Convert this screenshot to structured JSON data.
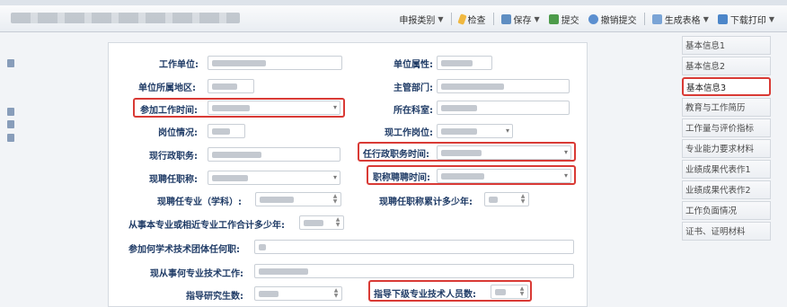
{
  "toolbar": {
    "category_label": "申报类别",
    "check_label": "检查",
    "save_label": "保存",
    "submit_label": "提交",
    "revoke_label": "撤销提交",
    "generate_label": "生成表格",
    "download_label": "下载打印"
  },
  "form": {
    "work_unit": "工作单位:",
    "unit_attr": "单位属性:",
    "unit_region": "单位所属地区:",
    "supervisor": "主管部门:",
    "join_work_time": "参加工作时间:",
    "department": "所在科室:",
    "post_status": "岗位情况:",
    "current_post": "现工作岗位:",
    "admin_position": "现行政职务:",
    "admin_position_time": "任行政职务时间:",
    "current_title": "现聘任职称:",
    "title_hire_time": "职称聘聘时间:",
    "current_major": "现聘任专业（学科）:",
    "title_years": "现聘任职称累计多少年:",
    "related_years": "从事本专业或相近专业工作合计多少年:",
    "academic_groups": "参加何学术技术团体任何职:",
    "current_tech_work": "现从事何专业技术工作:",
    "grad_students": "指导研究生数:",
    "guided_staff": "指导下级专业技术人员数:"
  },
  "sidebar": {
    "items": [
      {
        "label": "基本信息1"
      },
      {
        "label": "基本信息2"
      },
      {
        "label": "基本信息3"
      },
      {
        "label": "教育与工作简历"
      },
      {
        "label": "工作量与评价指标"
      },
      {
        "label": "专业能力要求材料"
      },
      {
        "label": "业绩成果代表作1"
      },
      {
        "label": "业绩成果代表作2"
      },
      {
        "label": "工作负面情况"
      },
      {
        "label": "证书、证明材料"
      }
    ]
  },
  "colors": {
    "highlight": "#d93a35",
    "label": "#1f3b66"
  }
}
